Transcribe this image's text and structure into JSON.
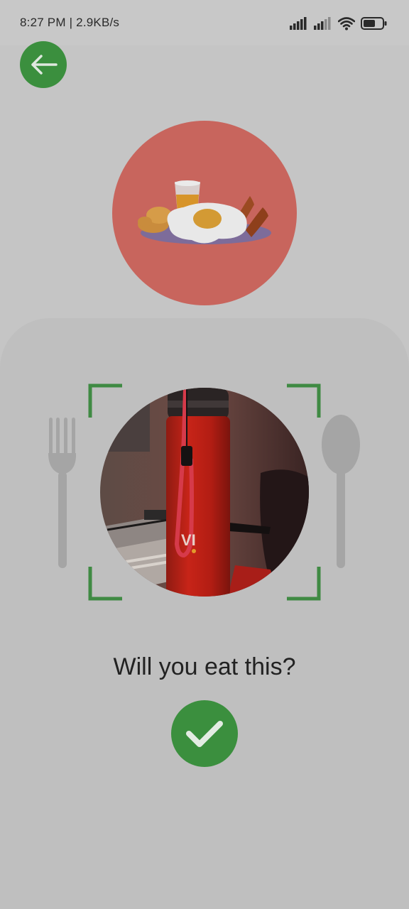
{
  "status_bar": {
    "time_speed": "8:27 PM | 2.9KB/s",
    "icons": [
      "signal-icon",
      "signal-icon",
      "wifi-icon",
      "battery-icon"
    ]
  },
  "header": {
    "back_icon": "arrow-left-icon"
  },
  "meal": {
    "icon": "breakfast-plate-icon"
  },
  "scan": {
    "left_icon": "fork-icon",
    "right_icon": "spoon-icon",
    "photo": "captured-food-photo"
  },
  "prompt": {
    "question": "Will you eat this?",
    "confirm_icon": "checkmark-icon"
  },
  "colors": {
    "accent_green": "#3b8f3e",
    "meal_circle": "#c8655d",
    "background": "#c5c5c5",
    "panel": "#bfbfbf"
  }
}
